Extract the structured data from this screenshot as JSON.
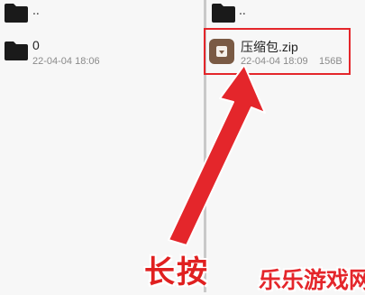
{
  "left_pane": {
    "items": [
      {
        "name": "..",
        "icon": "folder-icon"
      },
      {
        "name": "0",
        "date": "22-04-04 18:06",
        "icon": "folder-icon"
      }
    ]
  },
  "right_pane": {
    "items": [
      {
        "name": "..",
        "icon": "folder-icon"
      },
      {
        "name": "压缩包.zip",
        "date": "22-04-04 18:09",
        "size": "156B",
        "icon": "zip-archive-icon"
      }
    ]
  },
  "annotation": {
    "hint_text": "长按",
    "highlight_color": "#e4262b"
  },
  "watermark": "乐乐游戏网",
  "colors": {
    "folder": "#1a1a1a",
    "zip_icon": "#7a5a44",
    "accent_red": "#e4262b"
  }
}
